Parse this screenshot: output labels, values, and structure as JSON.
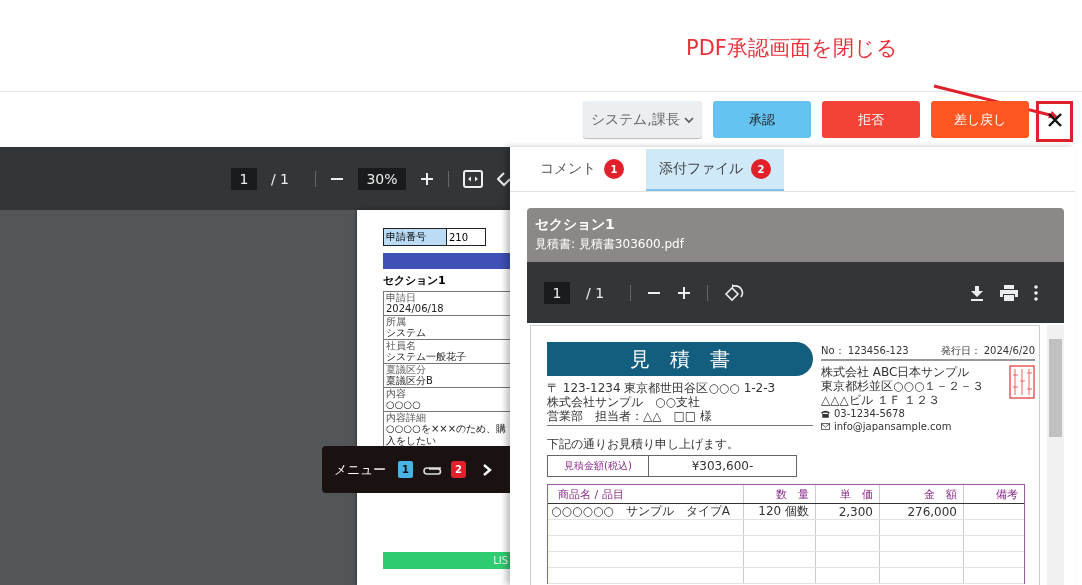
{
  "annotation": {
    "text": "PDF承認画面を閉じる"
  },
  "toolbar": {
    "approver": "システム,課長",
    "buttons": [
      {
        "label": "承認",
        "kind": "approve"
      },
      {
        "label": "拒否",
        "kind": "reject"
      },
      {
        "label": "差し戻し",
        "kind": "return"
      }
    ]
  },
  "main_viewer": {
    "page": "1",
    "page_total": "/ 1",
    "zoom": "30%",
    "form": {
      "number_label": "申請番号",
      "number": "210",
      "section": "セクション1",
      "fields": [
        {
          "label": "申請日",
          "value": "2024/06/18"
        },
        {
          "label": "所属",
          "value": "システム"
        },
        {
          "label": "社員名",
          "value": "システム一般花子"
        },
        {
          "label": "稟議区分",
          "value": "稟議区分B"
        },
        {
          "label": "内容",
          "value": "○○○○"
        },
        {
          "label": "内容詳細",
          "value": "○○○○を×××のため、購入をしたい"
        }
      ],
      "footer_bar": "LIS"
    }
  },
  "menu_popup": {
    "label": "メニュー",
    "comment_count": "1",
    "attachment_count": "2"
  },
  "side_panel": {
    "tabs": [
      {
        "label": "コメント",
        "badge": "1",
        "selected": false
      },
      {
        "label": "添付ファイル",
        "badge": "2",
        "selected": true
      }
    ],
    "attachment": {
      "section": "セクション1",
      "file": "見積書: 見積書303600.pdf",
      "page": "1",
      "page_total": "/ 1",
      "quote": {
        "title": "見　積　書",
        "no": "No： 123456-123",
        "issued": "発行日： 2024/6/20",
        "recipient": [
          "〒 123-1234 東京都世田谷区○○○ 1-2-3",
          "株式会社サンプル　○○支社",
          "営業部　担当者：△△　□□ 様"
        ],
        "issuer": [
          "株式会社 ABC日本サンプル",
          "東京都杉並区○○○１－２－３",
          "△△△ビル １Ｆ １２３"
        ],
        "phone": "03-1234-5678",
        "email": "info@japansample.com",
        "note": "下記の通りお見積り申し上げます。",
        "total_label": "見積金額(税込)",
        "total": "¥303,600-",
        "columns": [
          "商品名 / 品目",
          "数　量",
          "単　価",
          "金　額",
          "備考"
        ],
        "rows": [
          {
            "item": "○○○○○○　サンプル　タイプA",
            "qty": "120 個数",
            "price": "2,300",
            "amount": "276,000"
          }
        ]
      }
    }
  }
}
